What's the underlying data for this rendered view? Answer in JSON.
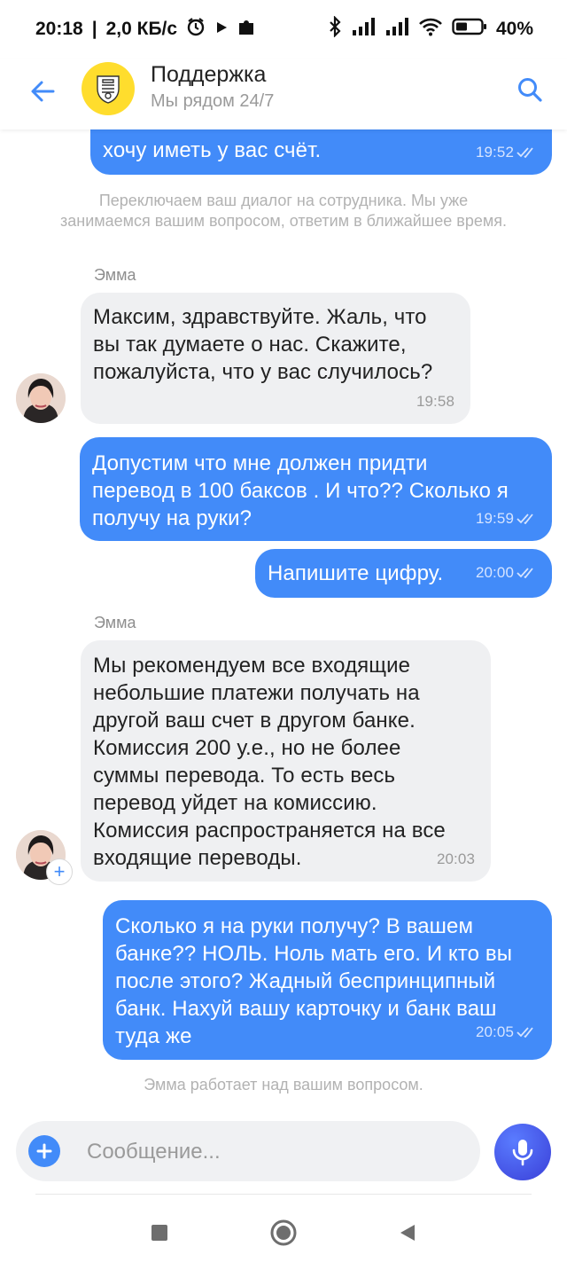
{
  "status_bar": {
    "time": "20:18",
    "network_speed": "2,0 КБ/с",
    "battery": "40%",
    "icons": [
      "alarm-icon",
      "play-icon",
      "puzzle-icon",
      "bluetooth-icon",
      "signal-icon",
      "signal-icon",
      "wifi-icon",
      "battery-icon"
    ]
  },
  "header": {
    "title": "Поддержка",
    "subtitle": "Мы рядом 24/7",
    "accent": "#428bf9",
    "logo_bg": "#ffdd2d"
  },
  "chat": {
    "messages": [
      {
        "type": "out",
        "text": "хочу иметь у вас счёт.",
        "time": "19:52"
      },
      {
        "type": "system",
        "text": "Переключаем ваш диалог на сотрудника. Мы уже занимаемся вашим вопросом, ответим в ближайшее время."
      },
      {
        "type": "sender",
        "text": "Эмма"
      },
      {
        "type": "in",
        "text": "Максим, здравствуйте. Жаль, что\nвы так думаете о нас. Скажите,\nпожалуйста, что у вас случилось?",
        "time": "19:58"
      },
      {
        "type": "out",
        "text": "Допустим что мне должен придти\nперевод в 100 баксов . И что?? Сколько я\nполучу на руки?",
        "time": "19:59"
      },
      {
        "type": "out",
        "text": "Напишите цифру.",
        "time": "20:00"
      },
      {
        "type": "sender",
        "text": "Эмма"
      },
      {
        "type": "in",
        "text": "Мы рекомендуем все входящие\nнебольшие платежи получать на\nдругой ваш счет в другом банке.\nКомиссия 200 у.е., но не более\nсуммы перевода. То есть весь\nперевод уйдет на комиссию.\nКомиссия распространяется на все\nвходящие переводы.",
        "time": "20:03"
      },
      {
        "type": "out",
        "text": "Сколько я на руки получу? В вашем\nбанке?? НОЛЬ. Ноль мать его. И кто вы\nпосле этого? Жадный беспринципный\nбанк. Нахуй вашу карточку и банк ваш\nтуда же",
        "time": "20:05"
      },
      {
        "type": "system",
        "text": "Эмма работает над вашим вопросом."
      }
    ]
  },
  "composer": {
    "placeholder": "Сообщение..."
  }
}
